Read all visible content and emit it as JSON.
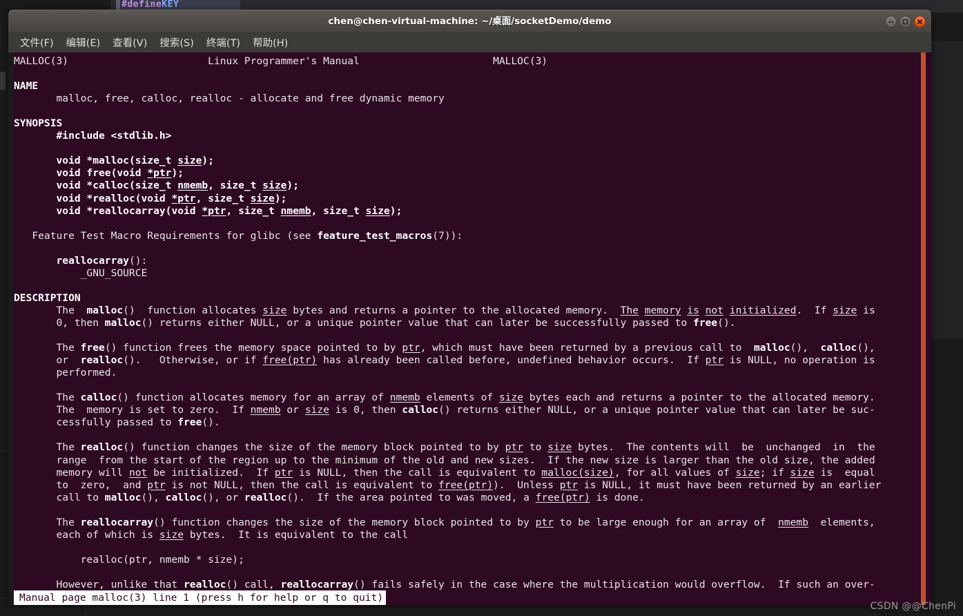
{
  "background": {
    "code_fragment": "#define",
    "code_fragment_2": "KEY"
  },
  "window": {
    "title": "chen@chen-virtual-machine: ~/桌面/socketDemo/demo",
    "controls": [
      {
        "name": "minimize",
        "label": "–"
      },
      {
        "name": "maximize",
        "label": "□"
      },
      {
        "name": "close",
        "label": "×"
      }
    ]
  },
  "menubar": {
    "items": [
      {
        "label": "文件(F)"
      },
      {
        "label": "编辑(E)"
      },
      {
        "label": "查看(V)"
      },
      {
        "label": "搜索(S)"
      },
      {
        "label": "终端(T)"
      },
      {
        "label": "帮助(H)"
      }
    ]
  },
  "manpage": {
    "header_left": "MALLOC(3)",
    "header_center": "Linux Programmer's Manual",
    "header_right": "MALLOC(3)",
    "sections": {
      "name_heading": "NAME",
      "name_body": "malloc, free, calloc, realloc - allocate and free dynamic memory",
      "synopsis_heading": "SYNOPSIS",
      "synopsis_include": "#include <stdlib.h>",
      "synopsis_protos": [
        "void *malloc(size_t size);",
        "void free(void *ptr);",
        "void *calloc(size_t nmemb, size_t size);",
        "void *realloc(void *ptr, size_t size);",
        "void *reallocarray(void *ptr, size_t nmemb, size_t size);"
      ],
      "feature_test_line": "Feature Test Macro Requirements for glibc (see feature_test_macros(7)):",
      "feature_test_func": "reallocarray():",
      "feature_test_macro": "_GNU_SOURCE",
      "description_heading": "DESCRIPTION",
      "paragraphs": [
        "The  malloc()  function allocates size bytes and returns a pointer to the allocated memory.  The memory is not initialized.  If size is 0, then malloc() returns either NULL, or a unique pointer value that can later be successfully passed to free().",
        "The free() function frees the memory space pointed to by ptr, which must have been returned by a previous call to  malloc(),  calloc(), or  realloc().   Otherwise, or if free(ptr) has already been called before, undefined behavior occurs.  If ptr is NULL, no operation is performed.",
        "The calloc() function allocates memory for an array of nmemb elements of size bytes each and returns a pointer to the allocated memory.  The  memory is set to zero.  If nmemb or size is 0, then calloc() returns either NULL, or a unique pointer value that can later be successfully passed to free().",
        "The realloc() function changes the size of the memory block pointed to by ptr to size bytes.  The contents will  be  unchanged  in  the range  from the start of the region up to the minimum of the old and new sizes.  If the new size is larger than the old size, the added memory will not be initialized.  If ptr is NULL, then the call is equivalent to malloc(size), for all values of size; if size is  equal to  zero,  and ptr is not NULL, then the call is equivalent to free(ptr).  Unless ptr is NULL, it must have been returned by an earlier call to malloc(), calloc(), or realloc().  If the area pointed to was moved, a free(ptr) is done.",
        "The reallocarray() function changes the size of the memory block pointed to by ptr to be large enough for an array of  nmemb  elements, each of which is size bytes.  It is equivalent to the call",
        "realloc(ptr, nmemb * size);",
        "However, unlike that realloc() call, reallocarray() fails safely in the case where the multiplication would overflow.  If such an over-"
      ]
    }
  },
  "status_bar": {
    "text": "Manual page malloc(3) line 1 (press h for help or q to quit)"
  },
  "watermark": {
    "text": "CSDN @@ChenPi"
  },
  "colors": {
    "terminal_bg": "#2d0922",
    "titlebar": "#504d49",
    "menubar": "#3c3b37",
    "scrollbar": "#c4512e",
    "close_button": "#d94715",
    "text": "#e8e4e6"
  }
}
